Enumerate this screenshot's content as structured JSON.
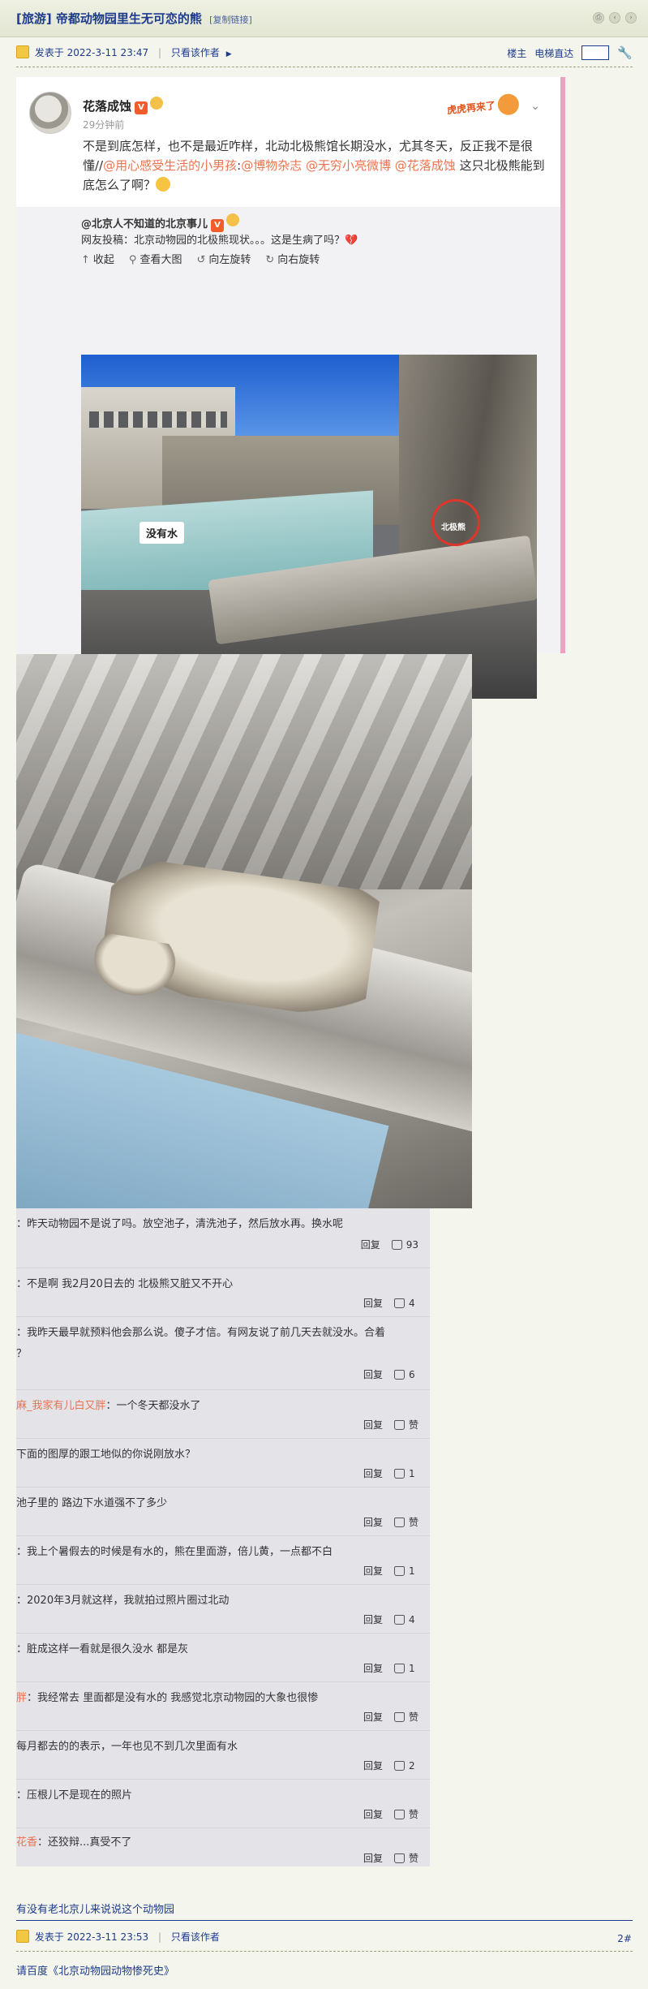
{
  "thread": {
    "title": "[旅游] 帝都动物园里生无可恋的熊",
    "copy_link": "[复制链接]"
  },
  "post1_meta": {
    "posted": "发表于 2022-3-11 23:47",
    "only_author": "只看该作者",
    "floor": "楼主",
    "elevator": "电梯直达"
  },
  "weibo": {
    "user": "花落成蚀",
    "time": "29分钟前",
    "sticker": "虎虎再来了",
    "text_plain1": "不是到底怎样，也不是最近咋样，北动北极熊馆长期没水，尤其冬天，反正我不是很懂//",
    "mention1": "@用心感受生活的小男孩",
    "text_colon1": ":",
    "mention2": "@博物杂志",
    "mention3": "@无穷小亮微博",
    "mention4": "@花落成蚀",
    "text_plain2": " 这只北极熊能到底怎么了啊？"
  },
  "repost": {
    "user": "@北京人不知道的北京事儿",
    "text": "网友投稿：北京动物园的北极熊现状。。。这是生病了吗？",
    "collapse": "收起",
    "view_large": "查看大图",
    "rotate_left": "向左旋转",
    "rotate_right": "向右旋转"
  },
  "photo_labels": {
    "no_water": "没有水",
    "polar_bear": "北极熊"
  },
  "comments": [
    {
      "name": "",
      "text": "：昨天动物园不是说了吗。放空池子，清洗池子，然后放水再。换水呢",
      "reply": "回复",
      "likes": "93"
    },
    {
      "name": "",
      "text": "：不是啊 我2月20日去的 北极熊又脏又不开心",
      "reply": "回复",
      "likes": "4"
    },
    {
      "name": "",
      "text": "：我昨天最早就预料他会那么说。傻子才信。有网友说了前几天去就没水。合着",
      "text2": "？",
      "reply": "回复",
      "likes": "6"
    },
    {
      "name": "麻_我家有儿白又胖",
      "text": "：一个冬天都没水了",
      "reply": "回复",
      "likes": "赞"
    },
    {
      "name": "",
      "text": "下面的图厚的跟工地似的你说刚放水？",
      "reply": "回复",
      "likes": "1"
    },
    {
      "name": "",
      "text": "池子里的 路边下水道强不了多少",
      "reply": "回复",
      "likes": "赞"
    },
    {
      "name": "",
      "text": "：我上个暑假去的时候是有水的，熊在里面游，倍儿黄，一点都不白",
      "reply": "回复",
      "likes": "1"
    },
    {
      "name": "",
      "text": "：2020年3月就这样，我就拍过照片圈过北动",
      "reply": "回复",
      "likes": "4"
    },
    {
      "name": "",
      "text": "：脏成这样一看就是很久没水 都是灰",
      "reply": "回复",
      "likes": "1"
    },
    {
      "name": "胖",
      "text": "：我经常去 里面都是没有水的 我感觉北京动物园的大象也很惨",
      "reply": "回复",
      "likes": "赞"
    },
    {
      "name": "",
      "text": "每月都去的的表示，一年也见不到几次里面有水",
      "reply": "回复",
      "likes": "2"
    },
    {
      "name": "",
      "text": "：压根儿不是现在的照片",
      "reply": "回复",
      "likes": "赞"
    },
    {
      "name": "花香",
      "text": "：还狡辩...真受不了",
      "reply": "回复",
      "likes": "赞"
    }
  ],
  "post_body_tail": "有没有老北京儿来说说这个动物园",
  "post2_meta": {
    "posted": "发表于 2022-3-11 23:53",
    "only_author": "只看该作者",
    "floor": "2#"
  },
  "search_link": "请百度《北京动物园动物惨死史》"
}
